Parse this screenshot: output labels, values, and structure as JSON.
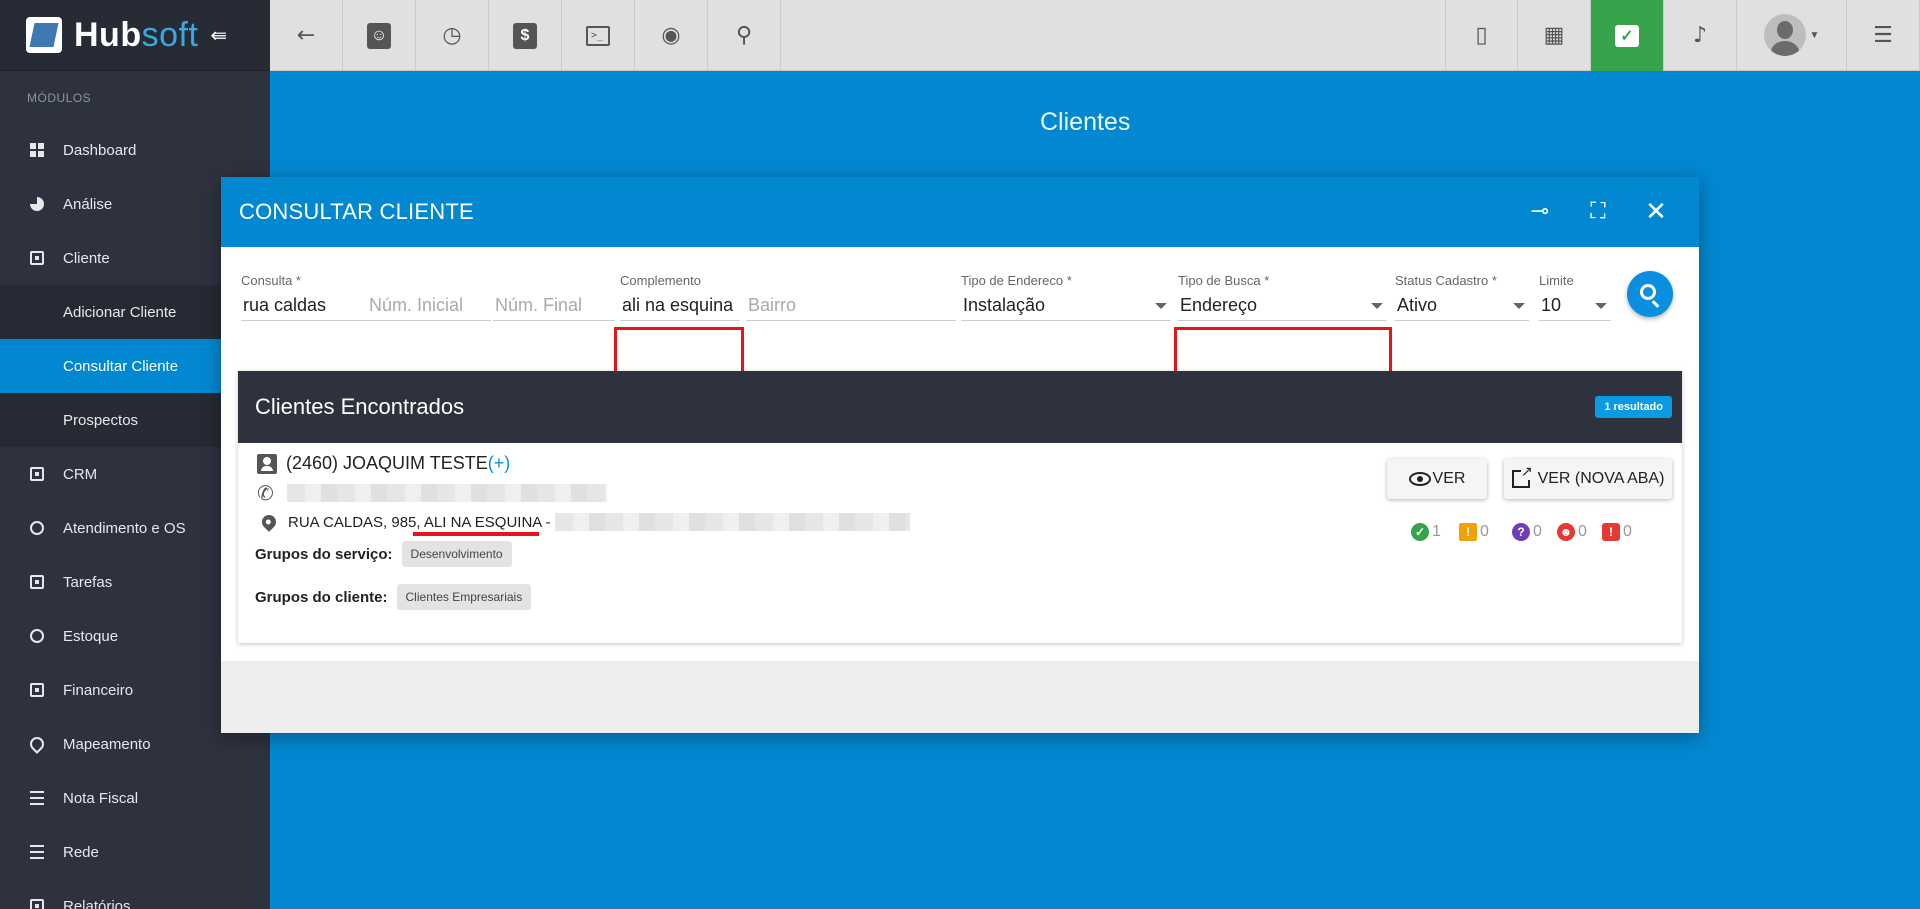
{
  "app": {
    "brand_primary": "Hub",
    "brand_secondary": "soft",
    "accent": "#0288d1"
  },
  "sidebar": {
    "section_label": "MÓDULOS",
    "items": [
      {
        "label": "Dashboard",
        "icon": "grid-icon"
      },
      {
        "label": "Análise",
        "icon": "pie-chart-icon"
      },
      {
        "label": "Cliente",
        "icon": "contact-icon"
      },
      {
        "label": "Adicionar Cliente",
        "sub": true
      },
      {
        "label": "Consultar Cliente",
        "sub": true,
        "active": true
      },
      {
        "label": "Prospectos",
        "sub": true
      },
      {
        "label": "CRM",
        "icon": "kanban-icon"
      },
      {
        "label": "Atendimento e OS",
        "icon": "calendar-clock-icon"
      },
      {
        "label": "Tarefas",
        "icon": "briefcase-icon"
      },
      {
        "label": "Estoque",
        "icon": "package-icon"
      },
      {
        "label": "Financeiro",
        "icon": "dollar-box-icon"
      },
      {
        "label": "Mapeamento",
        "icon": "map-pin-icon"
      },
      {
        "label": "Nota Fiscal",
        "icon": "invoice-icon"
      },
      {
        "label": "Rede",
        "icon": "server-icon"
      },
      {
        "label": "Relatórios",
        "icon": "report-icon"
      }
    ]
  },
  "page": {
    "title": "Clientes"
  },
  "modal": {
    "title": "CONSULTAR CLIENTE",
    "fields": {
      "consulta": {
        "label": "Consulta *",
        "value": "rua caldas"
      },
      "num_inicial": {
        "placeholder": "Núm. Inicial"
      },
      "num_final": {
        "placeholder": "Núm. Final"
      },
      "complemento": {
        "label": "Complemento",
        "value": "ali na esquina"
      },
      "bairro": {
        "placeholder": "Bairro"
      },
      "tipo_endereco": {
        "label": "Tipo de Endereco *",
        "value": "Instalação"
      },
      "tipo_busca": {
        "label": "Tipo de Busca *",
        "value": "Endereço"
      },
      "status_cadastro": {
        "label": "Status Cadastro *",
        "value": "Ativo"
      },
      "limite": {
        "label": "Limite",
        "value": "10"
      }
    },
    "results": {
      "title": "Clientes Encontrados",
      "count_badge": "1 resultado",
      "client": {
        "name": "(2460) JOAQUIM TESTE",
        "plus": "(+)",
        "address": "RUA CALDAS, 985, ALI NA ESQUINA -",
        "service_groups_label": "Grupos do serviço:",
        "service_group": "Desenvolvimento",
        "client_groups_label": "Grupos do cliente:",
        "client_group": "Clientes Empresariais",
        "btn_view": "VER",
        "btn_view_new_tab": "VER (NOVA ABA)",
        "stats": {
          "ok": "1",
          "warning": "0",
          "question": "0",
          "person": "0",
          "alert": "0"
        }
      }
    }
  },
  "colors": {
    "highlight": "#e8141c",
    "dark": "#2d323e",
    "green": "#37a34a"
  }
}
